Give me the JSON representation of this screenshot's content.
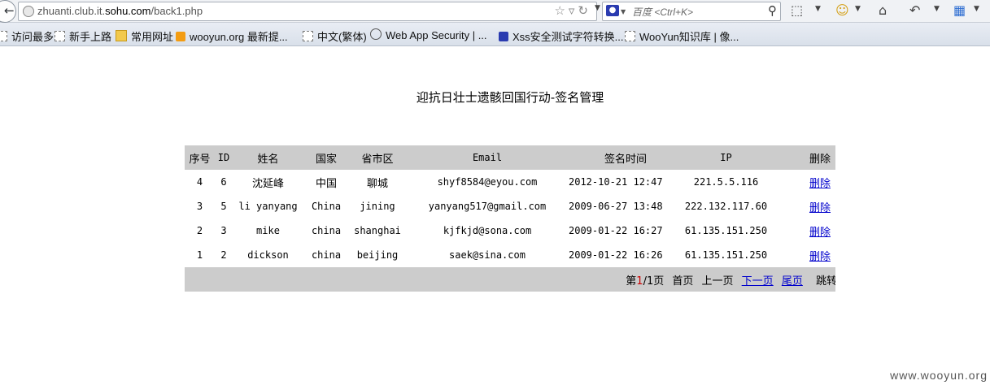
{
  "browser": {
    "url_host_prefix": "zhuanti.club.it.",
    "url_host_main": "sohu.com",
    "url_path": "/back1.php",
    "search_placeholder": "百度 <Ctrl+K>"
  },
  "bookmarks": [
    {
      "label": "访问最多",
      "icon": "page-icon"
    },
    {
      "label": "新手上路",
      "icon": "page-icon"
    },
    {
      "label": "常用网址",
      "icon": "folder-icon"
    },
    {
      "label": "wooyun.org 最新提...",
      "icon": "rss-icon"
    },
    {
      "label": "中文(繁体)",
      "icon": "page-icon"
    },
    {
      "label": "Web App Security | ...",
      "icon": "site-icon"
    },
    {
      "label": "Xss安全测试字符转换...",
      "icon": "paw-icon"
    },
    {
      "label": "WooYun知识库 | 像...",
      "icon": "page-icon"
    }
  ],
  "page": {
    "title": "迎抗日壮士遗骸回国行动-签名管理"
  },
  "table": {
    "headers": {
      "seq": "序号",
      "id": "ID",
      "name": "姓名",
      "country": "国家",
      "city": "省市区",
      "email": "Email",
      "time": "签名时间",
      "ip": "IP",
      "delete": "删除"
    },
    "rows": [
      {
        "seq": "4",
        "id": "6",
        "name": "沈延峰",
        "country": "中国",
        "city": "聊城",
        "email": "shyf8584@eyou.com",
        "time": "2012-10-21 12:47",
        "ip": "221.5.5.116",
        "delete": "删除"
      },
      {
        "seq": "3",
        "id": "5",
        "name": "li yanyang",
        "country": "China",
        "city": "jining",
        "email": "yanyang517@gmail.com",
        "time": "2009-06-27 13:48",
        "ip": "222.132.117.60",
        "delete": "删除"
      },
      {
        "seq": "2",
        "id": "3",
        "name": "mike",
        "country": "china",
        "city": "shanghai",
        "email": "kjfkjd@sona.com",
        "time": "2009-01-22 16:27",
        "ip": "61.135.151.250",
        "delete": "删除"
      },
      {
        "seq": "1",
        "id": "2",
        "name": "dickson",
        "country": "china",
        "city": "beijing",
        "email": "saek@sina.com",
        "time": "2009-01-22 16:26",
        "ip": "61.135.151.250",
        "delete": "删除"
      }
    ]
  },
  "pagination": {
    "page_prefix": "第",
    "current": "1",
    "page_suffix": "/1页",
    "first": "首页",
    "prev": "上一页",
    "next": "下一页",
    "last": "尾页",
    "jump": "跳转"
  },
  "watermark": "www.wooyun.org"
}
